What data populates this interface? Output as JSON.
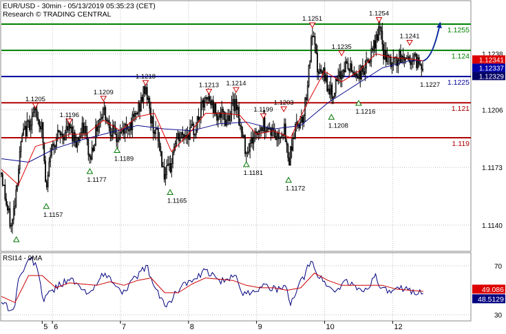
{
  "header": {
    "title": "EUR/USD - 30min - 05/13/2019 05:35:23 (CET)",
    "subtitle": "Research © TRADING CENTRAL"
  },
  "colors": {
    "candle": "#000000",
    "ma_fast": "#e00000",
    "ma_slow": "#0a0a90",
    "resistance": "#b00000",
    "pivot": "#000099",
    "target": "#008000",
    "arrow": "#0a2a9a",
    "grid": "#bbbbbb",
    "label_red_bg": "#dd0000",
    "label_blue_bg": "#0000aa",
    "label_navy_bg": "#000066",
    "rsi_line": "#000080",
    "rsi_ma": "#cc0000",
    "rsi_badge_red": "#dd0000",
    "rsi_badge_navy": "#000080"
  },
  "chart_data": [
    {
      "type": "candlestick",
      "title": "EUR/USD - 30min - 05/13/2019 05:35:23 (CET)",
      "ylim": [
        1.1125,
        1.1268
      ],
      "y_ticks": [
        1.114,
        1.1173,
        1.1206,
        1.1238
      ],
      "x_ticks": [
        {
          "label": "5",
          "day_pos": 0.6
        },
        {
          "label": "6",
          "day_pos": 0.75
        },
        {
          "label": "7",
          "day_pos": 1.75
        },
        {
          "label": "8",
          "day_pos": 2.75
        },
        {
          "label": "9",
          "day_pos": 3.75
        },
        {
          "label": "10",
          "day_pos": 4.75
        },
        {
          "label": "12",
          "day_pos": 5.75
        }
      ],
      "x_range": [
        0.0,
        6.9
      ],
      "price_path": [
        [
          0.0,
          1.117
        ],
        [
          0.08,
          1.115
        ],
        [
          0.15,
          1.1138
        ],
        [
          0.22,
          1.1162
        ],
        [
          0.3,
          1.119
        ],
        [
          0.4,
          1.1198
        ],
        [
          0.5,
          1.1205
        ],
        [
          0.6,
          1.1195
        ],
        [
          0.66,
          1.1157
        ],
        [
          0.72,
          1.1182
        ],
        [
          0.8,
          1.119
        ],
        [
          0.92,
          1.1192
        ],
        [
          1.0,
          1.1196
        ],
        [
          1.1,
          1.1188
        ],
        [
          1.22,
          1.1196
        ],
        [
          1.3,
          1.1177
        ],
        [
          1.4,
          1.1196
        ],
        [
          1.5,
          1.1207
        ],
        [
          1.6,
          1.1196
        ],
        [
          1.7,
          1.1189
        ],
        [
          1.8,
          1.1195
        ],
        [
          1.95,
          1.12
        ],
        [
          2.05,
          1.121
        ],
        [
          2.12,
          1.122
        ],
        [
          2.2,
          1.12
        ],
        [
          2.3,
          1.119
        ],
        [
          2.4,
          1.1168
        ],
        [
          2.48,
          1.1172
        ],
        [
          2.55,
          1.1188
        ],
        [
          2.7,
          1.1192
        ],
        [
          2.85,
          1.1195
        ],
        [
          2.95,
          1.1208
        ],
        [
          3.05,
          1.1212
        ],
        [
          3.15,
          1.1205
        ],
        [
          3.3,
          1.12
        ],
        [
          3.45,
          1.1212
        ],
        [
          3.52,
          1.1193
        ],
        [
          3.6,
          1.1183
        ],
        [
          3.7,
          1.119
        ],
        [
          3.85,
          1.1198
        ],
        [
          3.95,
          1.1195
        ],
        [
          4.05,
          1.119
        ],
        [
          4.15,
          1.1196
        ],
        [
          4.22,
          1.1176
        ],
        [
          4.28,
          1.119
        ],
        [
          4.35,
          1.1198
        ],
        [
          4.45,
          1.1204
        ],
        [
          4.52,
          1.123
        ],
        [
          4.57,
          1.125
        ],
        [
          4.65,
          1.1228
        ],
        [
          4.75,
          1.1225
        ],
        [
          4.85,
          1.1215
        ],
        [
          4.95,
          1.1222
        ],
        [
          5.05,
          1.1232
        ],
        [
          5.15,
          1.1228
        ],
        [
          5.25,
          1.1226
        ],
        [
          5.35,
          1.123
        ],
        [
          5.45,
          1.1238
        ],
        [
          5.55,
          1.1253
        ],
        [
          5.62,
          1.1238
        ],
        [
          5.7,
          1.1232
        ],
        [
          5.8,
          1.1234
        ],
        [
          5.9,
          1.1236
        ],
        [
          6.0,
          1.1235
        ],
        [
          6.1,
          1.1234
        ],
        [
          6.2,
          1.1232
        ]
      ],
      "ma_fast_path": [
        [
          0.0,
          1.1172
        ],
        [
          0.25,
          1.1163
        ],
        [
          0.5,
          1.1185
        ],
        [
          0.75,
          1.1188
        ],
        [
          1.0,
          1.1192
        ],
        [
          1.25,
          1.1192
        ],
        [
          1.5,
          1.12
        ],
        [
          1.75,
          1.1194
        ],
        [
          2.0,
          1.1202
        ],
        [
          2.25,
          1.1204
        ],
        [
          2.5,
          1.1182
        ],
        [
          2.75,
          1.1192
        ],
        [
          3.0,
          1.1204
        ],
        [
          3.25,
          1.1204
        ],
        [
          3.5,
          1.1203
        ],
        [
          3.75,
          1.1192
        ],
        [
          4.0,
          1.1194
        ],
        [
          4.25,
          1.119
        ],
        [
          4.5,
          1.121
        ],
        [
          4.75,
          1.1228
        ],
        [
          5.0,
          1.1222
        ],
        [
          5.25,
          1.1228
        ],
        [
          5.5,
          1.1238
        ],
        [
          5.75,
          1.1236
        ],
        [
          6.0,
          1.1235
        ],
        [
          6.2,
          1.1234
        ]
      ],
      "ma_slow_path": [
        [
          0.0,
          1.1178
        ],
        [
          0.4,
          1.1176
        ],
        [
          0.8,
          1.1184
        ],
        [
          1.2,
          1.1189
        ],
        [
          1.6,
          1.1193
        ],
        [
          2.0,
          1.1197
        ],
        [
          2.4,
          1.1195
        ],
        [
          2.8,
          1.1194
        ],
        [
          3.2,
          1.1198
        ],
        [
          3.6,
          1.1199
        ],
        [
          4.0,
          1.1195
        ],
        [
          4.4,
          1.1197
        ],
        [
          4.8,
          1.121
        ],
        [
          5.2,
          1.122
        ],
        [
          5.6,
          1.123
        ],
        [
          6.0,
          1.1234
        ],
        [
          6.2,
          1.1234
        ]
      ],
      "levels": [
        {
          "value": 1.1255,
          "label": "1.1255",
          "kind": "target"
        },
        {
          "value": 1.124,
          "label": "1.124",
          "kind": "target"
        },
        {
          "value": 1.1225,
          "label": "1.1225",
          "kind": "pivot"
        },
        {
          "value": 1.121,
          "label": "1.121",
          "kind": "resistance"
        },
        {
          "value": 1.119,
          "label": "1.119",
          "kind": "resistance"
        }
      ],
      "price_badges": [
        {
          "label": "1.12341",
          "kind": "red"
        },
        {
          "label": "1.12337",
          "kind": "blue"
        },
        {
          "label": "1.12329",
          "kind": "navy"
        }
      ],
      "projection": [
        [
          6.2,
          1.1234
        ],
        [
          6.45,
          1.1256
        ]
      ],
      "markers": [
        {
          "x": 0.5,
          "y": 1.1205,
          "dir": "down",
          "label": "1.1205"
        },
        {
          "x": 1.0,
          "y": 1.1196,
          "dir": "down",
          "label": "1.1196"
        },
        {
          "x": 1.5,
          "y": 1.1209,
          "dir": "down",
          "label": "1.1209"
        },
        {
          "x": 2.12,
          "y": 1.1218,
          "dir": "down",
          "label": "1.1218"
        },
        {
          "x": 3.05,
          "y": 1.1213,
          "dir": "down",
          "label": "1.1213"
        },
        {
          "x": 3.45,
          "y": 1.1214,
          "dir": "down",
          "label": "1.1214"
        },
        {
          "x": 3.85,
          "y": 1.1199,
          "dir": "down",
          "label": "1.1199"
        },
        {
          "x": 4.15,
          "y": 1.1203,
          "dir": "down",
          "label": "1.1203"
        },
        {
          "x": 4.57,
          "y": 1.1251,
          "dir": "down",
          "label": "1.1251"
        },
        {
          "x": 5.0,
          "y": 1.1235,
          "dir": "down",
          "label": "1.1235"
        },
        {
          "x": 5.55,
          "y": 1.1254,
          "dir": "down",
          "label": "1.1254"
        },
        {
          "x": 6.0,
          "y": 1.1241,
          "dir": "down",
          "label": "1.1241"
        },
        {
          "x": 0.22,
          "y": 1.1138,
          "dir": "up",
          "label": ""
        },
        {
          "x": 0.66,
          "y": 1.1157,
          "dir": "up",
          "label": "1.1157"
        },
        {
          "x": 1.3,
          "y": 1.1177,
          "dir": "up",
          "label": "1.1177"
        },
        {
          "x": 1.7,
          "y": 1.1189,
          "dir": "up",
          "label": "1.1189"
        },
        {
          "x": 2.48,
          "y": 1.1165,
          "dir": "up",
          "label": "1.1165"
        },
        {
          "x": 3.6,
          "y": 1.1181,
          "dir": "up",
          "label": "1.1181"
        },
        {
          "x": 4.22,
          "y": 1.1172,
          "dir": "up",
          "label": "1.1172"
        },
        {
          "x": 4.85,
          "y": 1.1208,
          "dir": "up",
          "label": "1.1208"
        },
        {
          "x": 5.25,
          "y": 1.1216,
          "dir": "up",
          "label": "1.1216"
        }
      ],
      "free_labels": [
        {
          "x": 6.3,
          "y": 1.1227,
          "label": "1.1227"
        }
      ]
    },
    {
      "type": "line",
      "title": "RSI14 - 9MA",
      "ylim": [
        25,
        80
      ],
      "y_ticks": [
        30,
        70
      ],
      "rsi_path": [
        [
          0.0,
          42
        ],
        [
          0.1,
          36
        ],
        [
          0.18,
          33
        ],
        [
          0.25,
          58
        ],
        [
          0.35,
          70
        ],
        [
          0.45,
          76
        ],
        [
          0.55,
          64
        ],
        [
          0.62,
          40
        ],
        [
          0.7,
          48
        ],
        [
          0.85,
          54
        ],
        [
          1.0,
          60
        ],
        [
          1.15,
          52
        ],
        [
          1.3,
          46
        ],
        [
          1.45,
          62
        ],
        [
          1.6,
          60
        ],
        [
          1.75,
          48
        ],
        [
          1.9,
          55
        ],
        [
          2.05,
          66
        ],
        [
          2.15,
          68
        ],
        [
          2.25,
          52
        ],
        [
          2.4,
          38
        ],
        [
          2.5,
          42
        ],
        [
          2.65,
          55
        ],
        [
          2.85,
          58
        ],
        [
          3.0,
          66
        ],
        [
          3.15,
          60
        ],
        [
          3.3,
          56
        ],
        [
          3.45,
          64
        ],
        [
          3.55,
          46
        ],
        [
          3.7,
          50
        ],
        [
          3.9,
          54
        ],
        [
          4.05,
          50
        ],
        [
          4.2,
          52
        ],
        [
          4.25,
          36
        ],
        [
          4.35,
          54
        ],
        [
          4.45,
          60
        ],
        [
          4.55,
          76
        ],
        [
          4.65,
          62
        ],
        [
          4.8,
          54
        ],
        [
          4.9,
          48
        ],
        [
          5.05,
          58
        ],
        [
          5.2,
          52
        ],
        [
          5.35,
          50
        ],
        [
          5.5,
          62
        ],
        [
          5.6,
          50
        ],
        [
          5.75,
          48
        ],
        [
          5.9,
          52
        ],
        [
          6.05,
          49
        ],
        [
          6.2,
          48.5
        ]
      ],
      "rsi_ma_path": [
        [
          0.0,
          45
        ],
        [
          0.2,
          40
        ],
        [
          0.4,
          62
        ],
        [
          0.6,
          62
        ],
        [
          0.8,
          52
        ],
        [
          1.0,
          56
        ],
        [
          1.2,
          55
        ],
        [
          1.4,
          54
        ],
        [
          1.6,
          57
        ],
        [
          1.8,
          54
        ],
        [
          2.0,
          58
        ],
        [
          2.2,
          60
        ],
        [
          2.4,
          48
        ],
        [
          2.6,
          48
        ],
        [
          2.8,
          55
        ],
        [
          3.0,
          60
        ],
        [
          3.2,
          59
        ],
        [
          3.4,
          58
        ],
        [
          3.6,
          54
        ],
        [
          3.8,
          52
        ],
        [
          4.0,
          52
        ],
        [
          4.2,
          50
        ],
        [
          4.4,
          52
        ],
        [
          4.6,
          64
        ],
        [
          4.8,
          58
        ],
        [
          5.0,
          54
        ],
        [
          5.2,
          54
        ],
        [
          5.4,
          54
        ],
        [
          5.6,
          54
        ],
        [
          5.8,
          51
        ],
        [
          6.0,
          50
        ],
        [
          6.2,
          49.1
        ]
      ],
      "badges": [
        {
          "label": "49.086",
          "kind": "red"
        },
        {
          "label": "48.5129",
          "kind": "navy"
        }
      ]
    }
  ]
}
